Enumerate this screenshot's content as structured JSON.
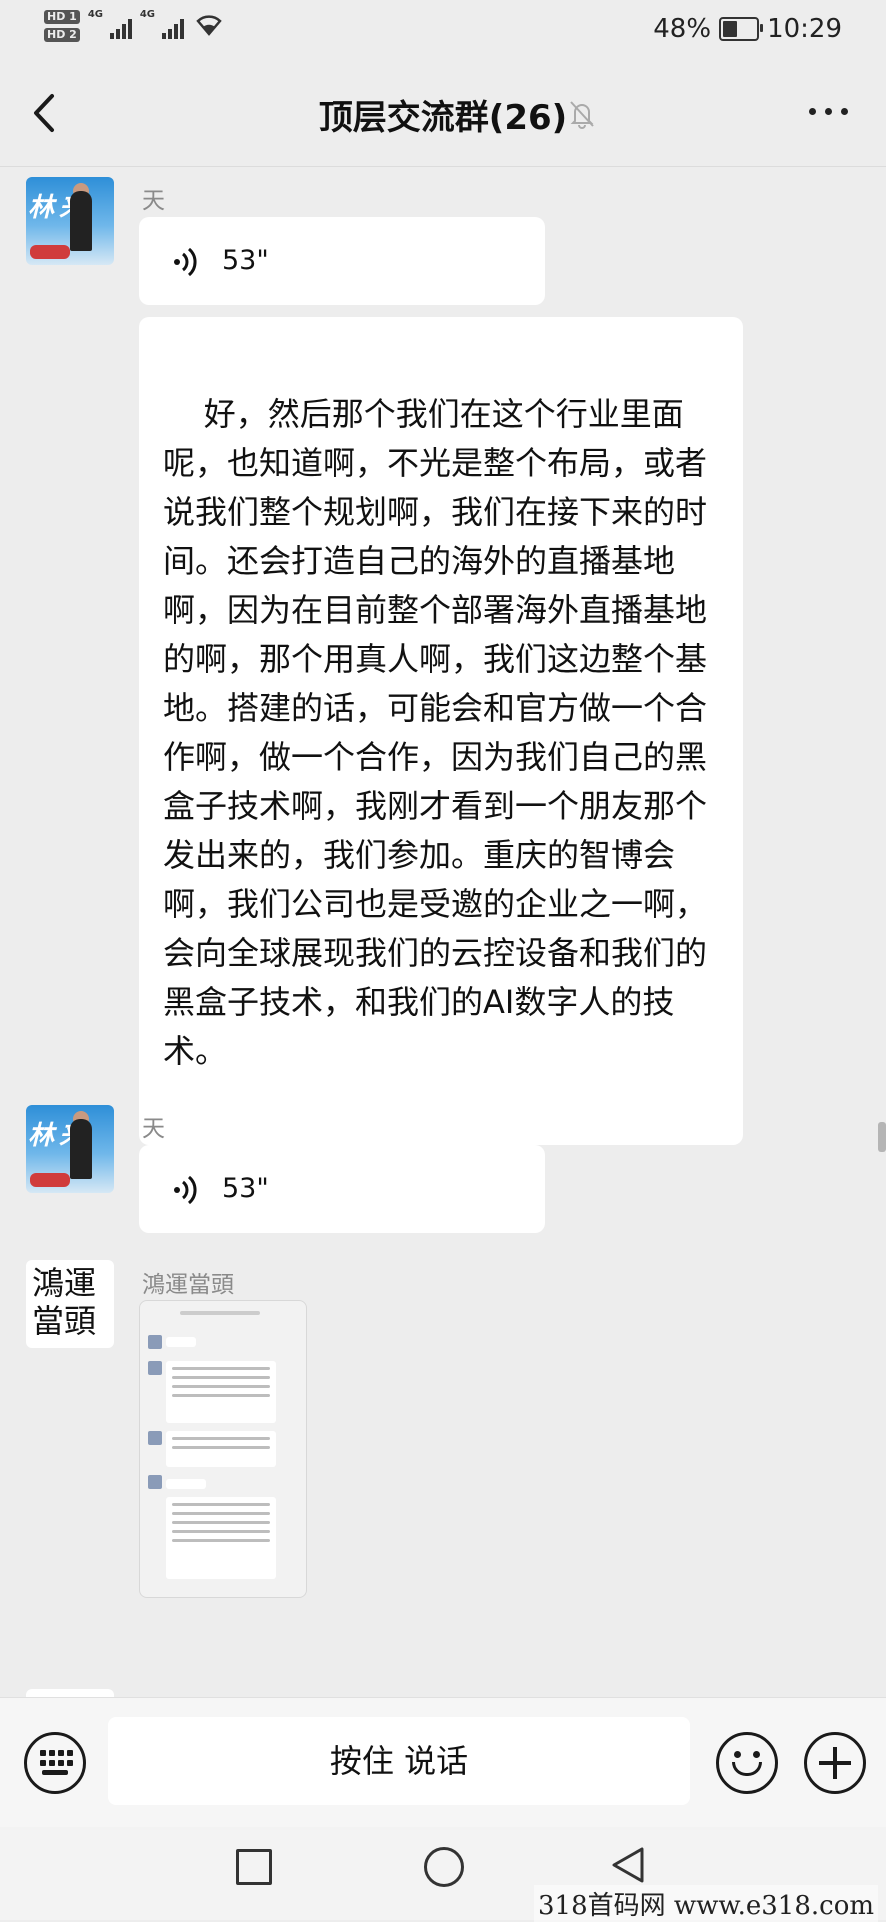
{
  "status_bar": {
    "hd1": "HD 1",
    "hd2": "HD 2",
    "net1": "4G",
    "net2": "4G",
    "battery_pct": "48%",
    "battery_level": 0.48,
    "time": "10:29"
  },
  "header": {
    "title": "顶层交流群(26)"
  },
  "messages": [
    {
      "sender": "天",
      "type": "voice",
      "duration": "53\""
    },
    {
      "type": "text",
      "text": "好，然后那个我们在这个行业里面呢，也知道啊，不光是整个布局，或者说我们整个规划啊，我们在接下来的时间。还会打造自己的海外的直播基地啊，因为在目前整个部署海外直播基地的啊，那个用真人啊，我们这边整个基地。搭建的话，可能会和官方做一个合作啊，做一个合作，因为我们自己的黑盒子技术啊，我刚才看到一个朋友那个发出来的，我们参加。重庆的智博会啊，我们公司也是受邀的企业之一啊，会向全球展现我们的云控设备和我们的黑盒子技术，和我们的AI数字人的技术。"
    },
    {
      "sender": "天",
      "type": "voice",
      "duration": "53\""
    },
    {
      "sender": "鴻運當頭",
      "type": "image"
    }
  ],
  "avatars": {
    "tian_text": "林 来",
    "hong_text": "鴻運當頭"
  },
  "input_bar": {
    "hold_to_talk": "按住 说话"
  },
  "watermark": "318首码网 www.e318.com"
}
